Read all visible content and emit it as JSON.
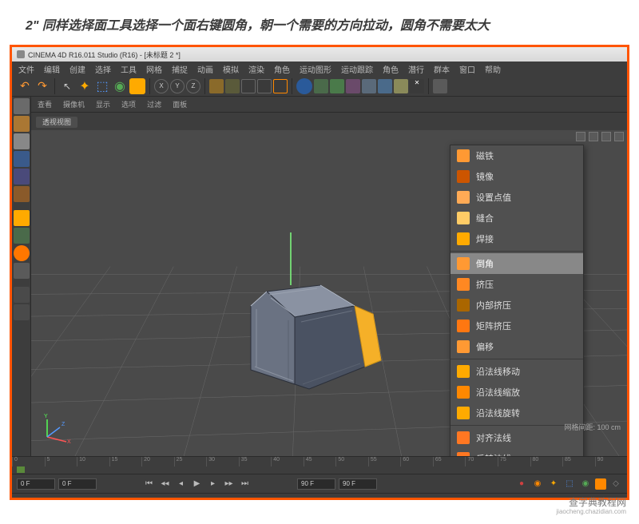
{
  "instruction": "2\" 同样选择面工具选择一个面右键圆角，朝一个需要的方向拉动，圆角不需要太大",
  "titlebar": {
    "text": "CINEMA 4D R16.011 Studio (R16) - [未标题 2 *]"
  },
  "menu": [
    "文件",
    "编辑",
    "创建",
    "选择",
    "工具",
    "网格",
    "捕捉",
    "动画",
    "模拟",
    "渲染",
    "角色",
    "运动图形",
    "运动跟踪",
    "角色",
    "潜行",
    "群本",
    "窗口",
    "帮助"
  ],
  "vp_tabs": [
    "查看",
    "摄像机",
    "显示",
    "选项",
    "过滤",
    "面板"
  ],
  "vp_label": "透视视图",
  "context_menu": {
    "items": [
      {
        "icon": "magnet",
        "color": "#ff9933",
        "label": "磁铁"
      },
      {
        "icon": "mirror",
        "color": "#cc5500",
        "label": "镜像"
      },
      {
        "icon": "points",
        "color": "#ffaa55",
        "label": "设置点值"
      },
      {
        "icon": "slide",
        "color": "#ffcc66",
        "label": "缝合"
      },
      {
        "icon": "weld",
        "color": "#ffaa00",
        "label": "焊接"
      },
      {
        "sep": true
      },
      {
        "icon": "bevel",
        "color": "#ff9933",
        "label": "倒角",
        "highlight": true
      },
      {
        "icon": "extrude",
        "color": "#ff8822",
        "label": "挤压"
      },
      {
        "icon": "inner",
        "color": "#aa6600",
        "label": "内部挤压"
      },
      {
        "icon": "matrix",
        "color": "#ff7711",
        "label": "矩阵挤压"
      },
      {
        "icon": "offset",
        "color": "#ff9933",
        "label": "偏移"
      },
      {
        "sep": true
      },
      {
        "icon": "nmove",
        "color": "#ffaa00",
        "label": "沿法线移动"
      },
      {
        "icon": "nscale",
        "color": "#ff8800",
        "label": "沿法线缩放"
      },
      {
        "icon": "nrot",
        "color": "#ffaa00",
        "label": "沿法线旋转"
      },
      {
        "sep": true
      },
      {
        "icon": "align",
        "color": "#ff7722",
        "label": "对齐法线"
      },
      {
        "icon": "reverse",
        "color": "#ff7722",
        "label": "反转法线"
      }
    ]
  },
  "timeline": {
    "ticks": [
      "0",
      "5",
      "10",
      "15",
      "20",
      "25",
      "30",
      "35",
      "40",
      "45",
      "50",
      "55",
      "60",
      "65",
      "70",
      "75",
      "80",
      "85",
      "90"
    ]
  },
  "playbar": {
    "start": "0 F",
    "cur": "0 F",
    "end1": "90 F",
    "end2": "90 F"
  },
  "grid_info": "网格间距: 100 cm",
  "watermark": {
    "main": "查字典教程网",
    "sub": "jiaocheng.chazidian.com"
  }
}
